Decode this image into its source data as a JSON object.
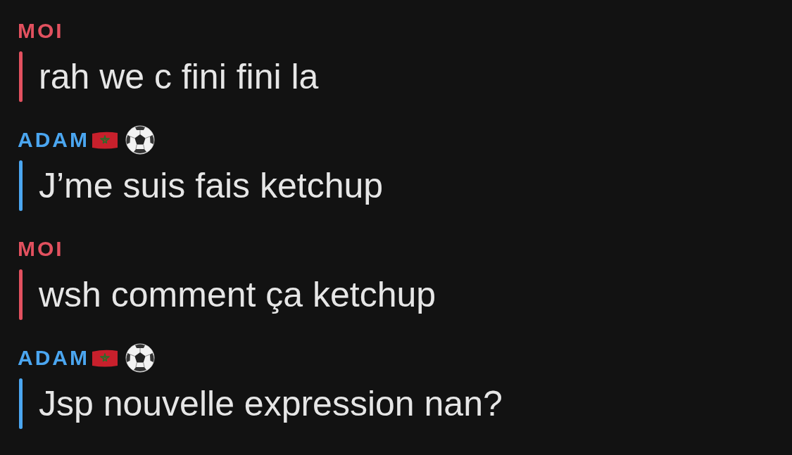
{
  "messages": [
    {
      "sender": "MOI",
      "kind": "self",
      "color": "#e2515f",
      "text": "rah we c fini fini la"
    },
    {
      "sender": "ADAM",
      "kind": "friend",
      "color": "#4ba6f0",
      "text": "J’me suis fais ketchup"
    },
    {
      "sender": "MOI",
      "kind": "self",
      "color": "#e2515f",
      "text": "wsh comment ça ketchup"
    },
    {
      "sender": "ADAM",
      "kind": "friend",
      "color": "#4ba6f0",
      "text": "Jsp nouvelle expression nan?"
    }
  ]
}
